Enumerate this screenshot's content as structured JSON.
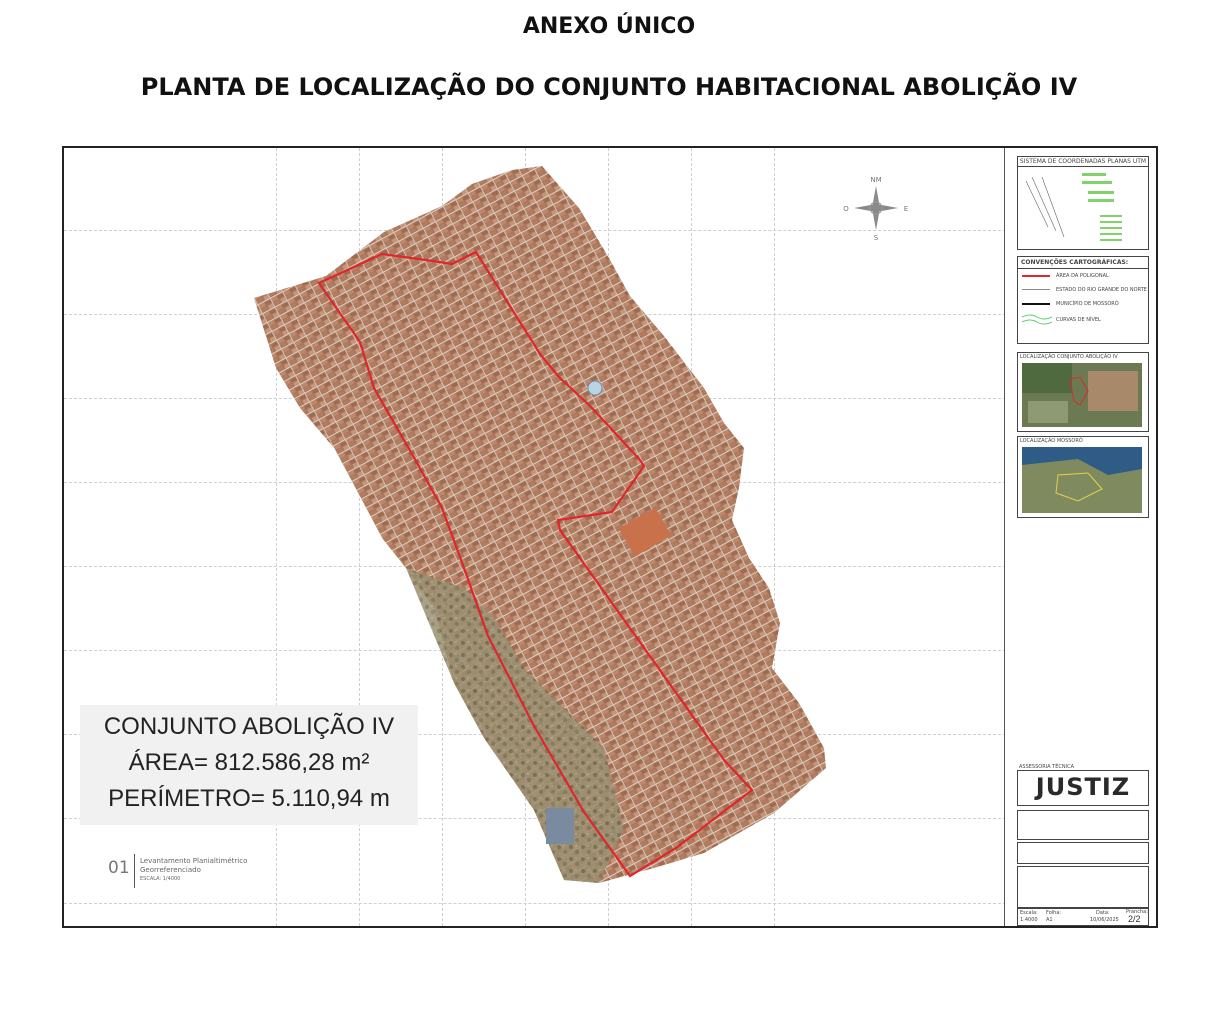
{
  "header": {
    "title": "ANEXO ÚNICO",
    "subtitle": "PLANTA DE LOCALIZAÇÃO DO CONJUNTO HABITACIONAL ABOLIÇÃO IV"
  },
  "info_box": {
    "line1": "CONJUNTO ABOLIÇÃO IV",
    "line2": "ÁREA= 812.586,28 m²",
    "line3": "PERÍMETRO= 5.110,94 m"
  },
  "drawing_label": {
    "number": "01",
    "line1": "Levantamento Planialtimétrico",
    "line2": "Georreferenciado",
    "scale": "ESCALA: 1/4000"
  },
  "legend_panel": {
    "coord_title": "SISTEMA DE COORDENADAS PLANAS UTM",
    "conventions_title": "CONVENÇÕES CARTOGRÁFICAS:",
    "conventions": [
      "ÁREA DA POLIGONAL",
      "ESTADO DO RIO GRANDE DO NORTE",
      "MUNICÍPIO DE MOSSORÓ",
      "CURVAS DE NÍVEL"
    ],
    "location1_title": "LOCALIZAÇÃO CONJUNTO ABOLIÇÃO IV",
    "location2_title": "LOCALIZAÇÃO MOSSORÓ",
    "technical": "ASSESSORIA TÉCNICA",
    "brand": "JUSTIZ",
    "sheet_label": "Prancha:",
    "sheet_number": "2/2",
    "scale_label": "Escala:",
    "scale_value": "1:4000",
    "format_label": "Folha:",
    "format_value": "A1",
    "date_label": "Data:",
    "date_value": "10/06/2025"
  },
  "colors": {
    "polygon": "#e0262b",
    "border": "#222222",
    "label_bg": "#f1f1f1"
  }
}
